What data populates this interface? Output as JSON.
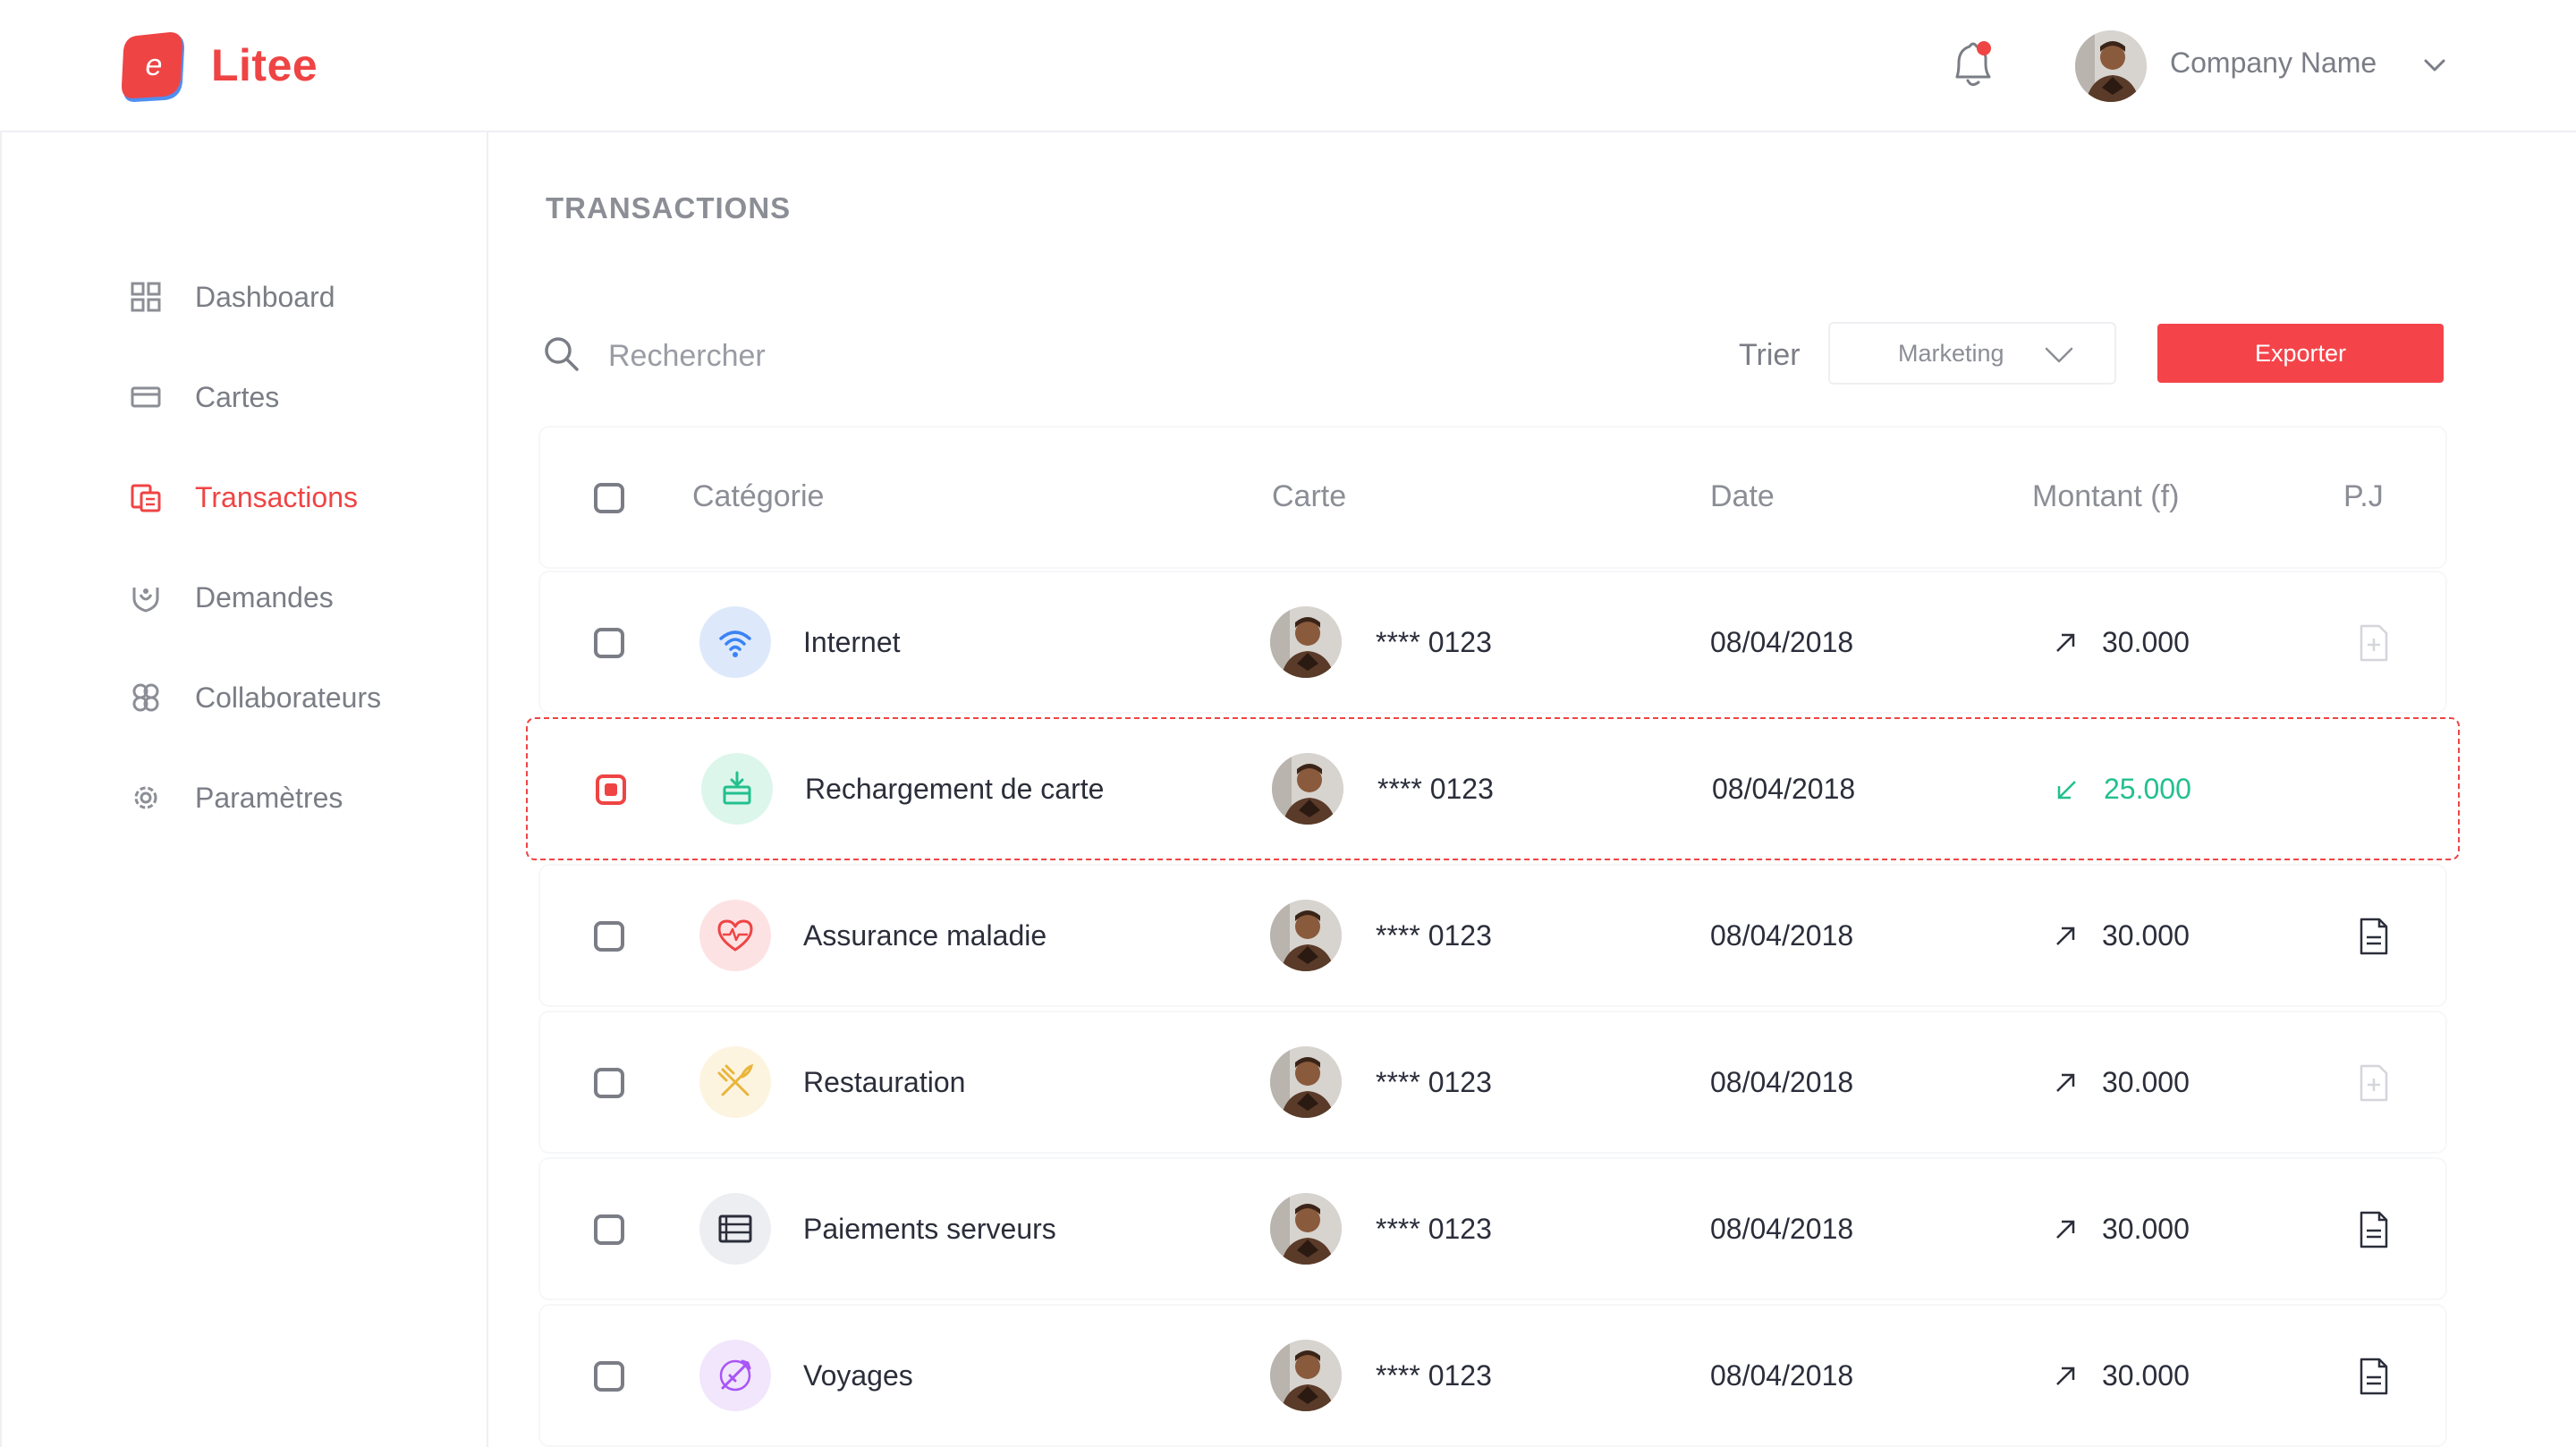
{
  "app": {
    "brand": "Litee"
  },
  "header": {
    "company": "Company Name"
  },
  "colors": {
    "accent": "#ef4444",
    "incoming": "#22c08e"
  },
  "sidebar": {
    "items": [
      {
        "label": "Dashboard",
        "icon": "dashboard-icon",
        "active": false
      },
      {
        "label": "Cartes",
        "icon": "card-icon",
        "active": false
      },
      {
        "label": "Transactions",
        "icon": "transactions-icon",
        "active": true
      },
      {
        "label": "Demandes",
        "icon": "requests-icon",
        "active": false
      },
      {
        "label": "Collaborateurs",
        "icon": "team-icon",
        "active": false
      },
      {
        "label": "Paramètres",
        "icon": "settings-icon",
        "active": false
      }
    ]
  },
  "main": {
    "title": "TRANSACTIONS",
    "search_placeholder": "Rechercher",
    "sort_label": "Trier",
    "sort_value": "Marketing",
    "export_label": "Exporter"
  },
  "table": {
    "columns": [
      "Catégorie",
      "Carte",
      "Date",
      "Montant (f)",
      "P.J"
    ],
    "rows": [
      {
        "category": "Internet",
        "icon": "wifi-icon",
        "card": "**** 0123",
        "date": "08/04/2018",
        "direction": "out",
        "amount": "30.000",
        "attachment": "add-file-icon",
        "checked": false
      },
      {
        "category": "Rechargement de carte",
        "icon": "card-reload-icon",
        "card": "**** 0123",
        "date": "08/04/2018",
        "direction": "in",
        "amount": "25.000",
        "attachment": "",
        "checked": true
      },
      {
        "category": "Assurance maladie",
        "icon": "heart-pulse-icon",
        "card": "**** 0123",
        "date": "08/04/2018",
        "direction": "out",
        "amount": "30.000",
        "attachment": "document-icon",
        "checked": false
      },
      {
        "category": "Restauration",
        "icon": "cutlery-icon",
        "card": "**** 0123",
        "date": "08/04/2018",
        "direction": "out",
        "amount": "30.000",
        "attachment": "add-file-icon",
        "checked": false
      },
      {
        "category": "Paiements serveurs",
        "icon": "server-icon",
        "card": "**** 0123",
        "date": "08/04/2018",
        "direction": "out",
        "amount": "30.000",
        "attachment": "document-icon",
        "checked": false
      },
      {
        "category": "Voyages",
        "icon": "plane-icon",
        "card": "**** 0123",
        "date": "08/04/2018",
        "direction": "out",
        "amount": "30.000",
        "attachment": "document-icon",
        "checked": false
      }
    ]
  }
}
